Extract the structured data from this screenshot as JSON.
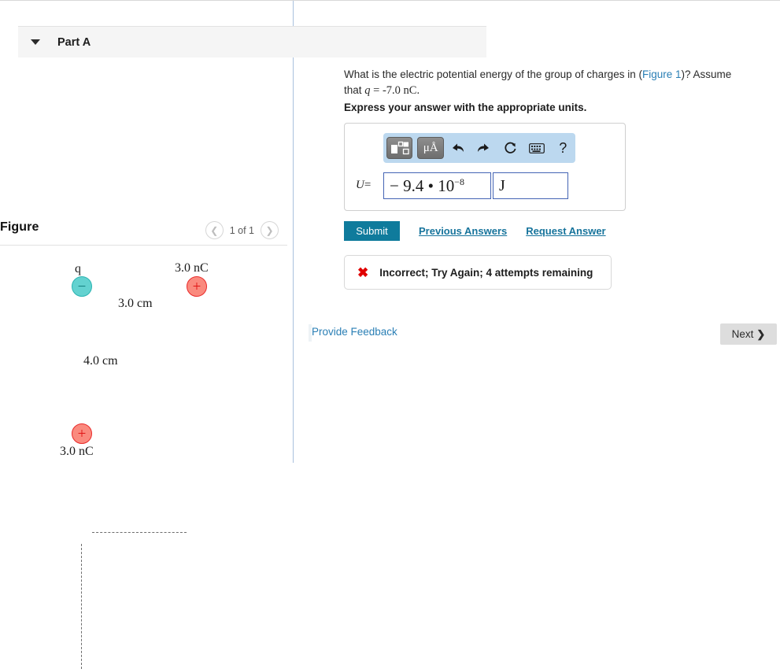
{
  "figure_panel": {
    "title": "Figure",
    "counter": "1 of 1",
    "prev_icon": "chevron-left-icon",
    "next_icon": "chevron-right-icon",
    "diagram": {
      "charges": [
        {
          "id": "q-negative",
          "sign": "−",
          "label": "q",
          "type": "negative"
        },
        {
          "id": "q-right-pos",
          "sign": "+",
          "label": "3.0 nC",
          "type": "positive"
        },
        {
          "id": "q-bottom-pos",
          "sign": "+",
          "label": "3.0 nC",
          "type": "positive"
        }
      ],
      "dimension_horizontal": "3.0 cm",
      "dimension_vertical": "4.0 cm",
      "negative_color": "#63d2d0",
      "positive_color": "#fa8a7e"
    }
  },
  "problem": {
    "part_label": "Part A",
    "caret_icon": "chevron-down-icon",
    "question_pre": "What is the electric potential energy of the group of charges in (",
    "question_link": "Figure 1",
    "question_post": ")? Assume that ",
    "question_var": "q",
    "question_eq": " = -7.0 nC.",
    "express_line": "Express your answer with the appropriate units.",
    "answer": {
      "variable": "U",
      "equals": "=",
      "value_mantissa": "− 9.4 • 10",
      "value_exponent": "−8",
      "unit": "J",
      "toolbar": [
        {
          "name": "template-icon",
          "glyph": ""
        },
        {
          "name": "units-micro-angstrom-icon",
          "glyph": "μÅ"
        },
        {
          "name": "undo-icon",
          "glyph": "⬅"
        },
        {
          "name": "redo-icon",
          "glyph": "➡"
        },
        {
          "name": "reset-icon",
          "glyph": "↺"
        },
        {
          "name": "keyboard-icon",
          "glyph": "⌨"
        },
        {
          "name": "help-icon",
          "glyph": "?"
        }
      ]
    },
    "submit_label": "Submit",
    "previous_answers_label": "Previous Answers",
    "request_answer_label": "Request Answer",
    "feedback": {
      "icon": "error-x-icon",
      "glyph": "✖",
      "message": "Incorrect; Try Again; 4 attempts remaining",
      "color": "#e00000"
    }
  },
  "footer": {
    "provide_feedback_label": "Provide Feedback",
    "next_label": "Next",
    "next_chevron": "❯"
  }
}
